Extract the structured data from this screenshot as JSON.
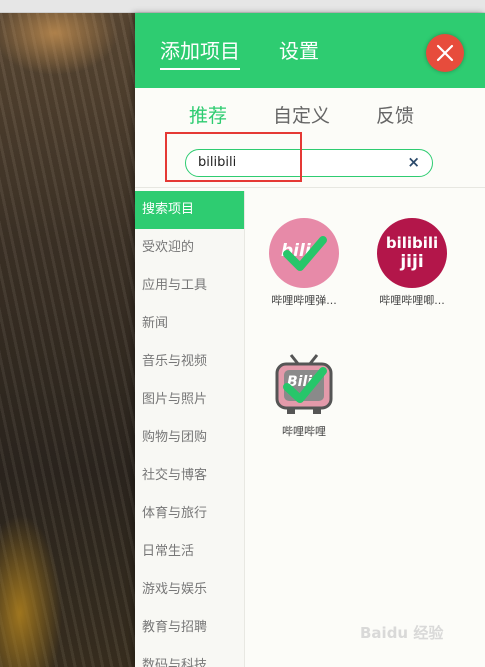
{
  "header": {
    "tabs": [
      {
        "label": "添加项目"
      },
      {
        "label": "设置"
      }
    ],
    "close_icon": "close-icon",
    "color": "#2ecc71"
  },
  "subtabs": [
    {
      "label": "推荐"
    },
    {
      "label": "自定义"
    },
    {
      "label": "反馈"
    }
  ],
  "search": {
    "value": "bilibili",
    "clear_glyph": "×"
  },
  "sidebar": {
    "items": [
      {
        "label": "搜索项目"
      },
      {
        "label": "受欢迎的"
      },
      {
        "label": "应用与工具"
      },
      {
        "label": "新闻"
      },
      {
        "label": "音乐与视频"
      },
      {
        "label": "图片与照片"
      },
      {
        "label": "购物与团购"
      },
      {
        "label": "社交与博客"
      },
      {
        "label": "体育与旅行"
      },
      {
        "label": "日常生活"
      },
      {
        "label": "游戏与娱乐"
      },
      {
        "label": "教育与招聘"
      },
      {
        "label": "数码与科技"
      }
    ]
  },
  "results": [
    {
      "label": "哔哩哔哩弹...",
      "icon_text": "bili",
      "added": true
    },
    {
      "label": "哔哩哔哩唧...",
      "icon_text_top": "bilibili",
      "icon_text_bottom": "jiji",
      "added": false
    },
    {
      "label": "哔哩哔哩",
      "icon_text": "Bili",
      "added": true
    }
  ],
  "watermark": {
    "text": "Baidu 经验"
  }
}
